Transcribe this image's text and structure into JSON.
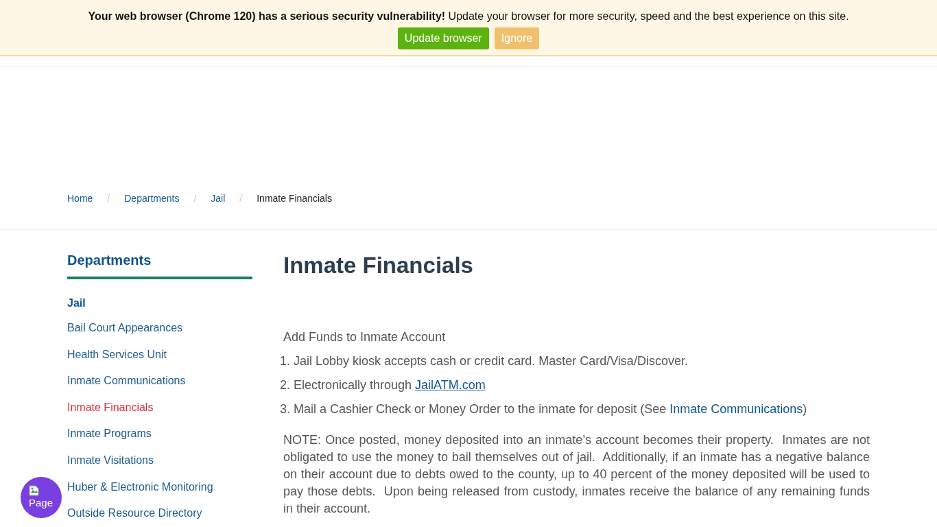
{
  "update_banner": {
    "message": "**Your web browser (Chrome 120) has a serious security vulnerability!** Update your browser for more security, speed and the best experience on this site.",
    "buttons": [
      {
        "label": "Update browser",
        "kind": "primary"
      },
      {
        "label": "Ignore",
        "kind": "secondary"
      }
    ]
  },
  "breadcrumb": {
    "items": [
      {
        "label": "Home",
        "current": false
      },
      {
        "label": "Departments",
        "current": false
      },
      {
        "label": "Jail",
        "current": false
      },
      {
        "label": "Inmate Financials",
        "current": true
      }
    ],
    "separators": [
      "/",
      "/",
      "/"
    ]
  },
  "sidebar": {
    "title": "Departments",
    "section": "Jail",
    "items": [
      {
        "label": "Bail Court Appearances",
        "selected": false
      },
      {
        "label": "Health Services Unit",
        "selected": false
      },
      {
        "label": "Inmate Communications",
        "selected": false
      },
      {
        "label": "Inmate Financials",
        "selected": true
      },
      {
        "label": "Inmate Programs",
        "selected": false
      },
      {
        "label": "Inmate Visitations",
        "selected": false
      },
      {
        "label": "Huber & Electronic Monitoring",
        "selected": false
      },
      {
        "label": "Outside Resource Directory",
        "selected": false
      }
    ]
  },
  "content": {
    "title": "Inmate Financials",
    "intro": "Add Funds to Inmate Account",
    "steps": [
      {
        "number": "1.",
        "parts": [
          {
            "kind": "text",
            "text": "Jail Lobby kiosk accepts cash or credit card. Master Card/Visa/Discover."
          }
        ]
      },
      {
        "number": "2.",
        "parts": [
          {
            "kind": "text",
            "text": "Electronically through "
          },
          {
            "kind": "link",
            "text": "JailATM.com",
            "underlined": true
          }
        ]
      },
      {
        "number": "3.",
        "parts": [
          {
            "kind": "text",
            "text": "Mail a Cashier Check or Money Order to the inmate for deposit (See "
          },
          {
            "kind": "link",
            "text": "Inmate Communications",
            "underlined": false
          },
          {
            "kind": "text",
            "text": ")"
          }
        ]
      }
    ],
    "note": "NOTE: Once posted, money deposited into an inmate’s account becomes their property.  Inmates are not obligated to use the money to bail themselves out of jail.  Additionally, if an inmate has a negative balance on their account due to debts owed to the county, up to 40 percent of the money deposited will be used to pay those debts.  Upon being released from custody, inmates receive the balance of any remaining funds in their account."
  },
  "chat_widget": {
    "label": "Page"
  }
}
